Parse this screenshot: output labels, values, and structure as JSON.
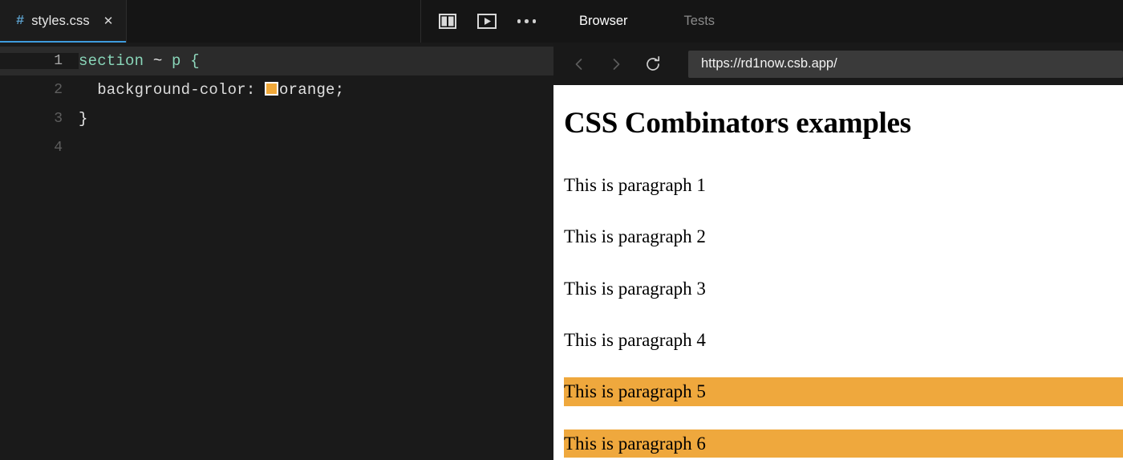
{
  "editor": {
    "tab": {
      "icon": "hash-icon",
      "filename": "styles.css",
      "close_label": "✕"
    },
    "actions": [
      {
        "name": "split-editor-icon",
        "label": "Split editor"
      },
      {
        "name": "preview-icon",
        "label": "Open preview"
      },
      {
        "name": "more-actions-icon",
        "label": "More actions"
      }
    ],
    "lines": [
      {
        "number": "1",
        "current": true,
        "selector": "section",
        "combinator": " ~ ",
        "element": "p",
        "open_brace": " {"
      },
      {
        "number": "2",
        "current": false,
        "property": "  background-color: ",
        "swatch_color": "#f0a839",
        "value": "orange;"
      },
      {
        "number": "3",
        "current": false,
        "text": "}"
      },
      {
        "number": "4",
        "current": false,
        "text": ""
      }
    ]
  },
  "browser": {
    "tabs": [
      {
        "label": "Browser",
        "active": true
      },
      {
        "label": "Tests",
        "active": false
      }
    ],
    "toolbar": {
      "back_icon": "chevron-left-icon",
      "forward_icon": "chevron-right-icon",
      "reload_icon": "reload-icon",
      "url": "https://rd1now.csb.app/"
    },
    "page": {
      "heading": "CSS Combinators examples",
      "paragraphs": [
        {
          "text": "This is paragraph 1",
          "highlighted": false
        },
        {
          "text": "This is paragraph 2",
          "highlighted": false
        },
        {
          "text": "This is paragraph 3",
          "highlighted": false
        },
        {
          "text": "This is paragraph 4",
          "highlighted": false
        },
        {
          "text": "This is paragraph 5",
          "highlighted": true
        },
        {
          "text": "This is paragraph 6",
          "highlighted": true
        }
      ]
    }
  },
  "colors": {
    "highlight_orange": "#efa83d",
    "tab_underline_blue": "#3e9bdd",
    "selector_green": "#89d6b9",
    "editor_background": "#1a1a1a"
  }
}
